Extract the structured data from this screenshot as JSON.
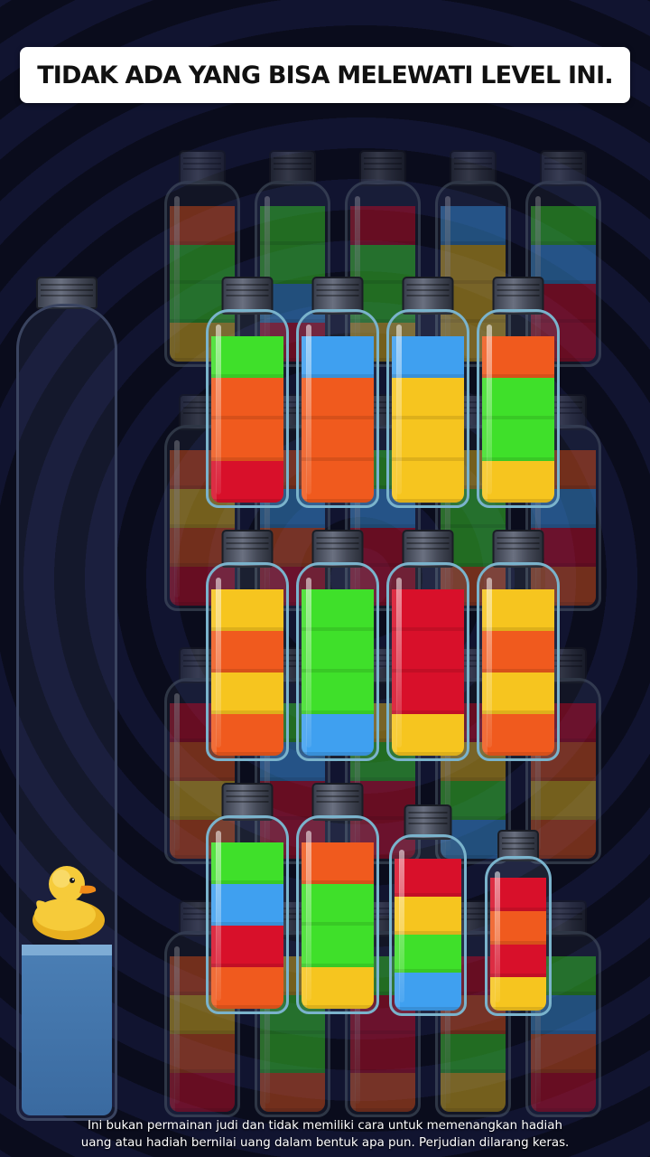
{
  "banner": {
    "title": "TIDAK ADA YANG BISA MELEWATI LEVEL INI."
  },
  "disclaimer": {
    "line1": "Ini bukan permainan judi dan tidak memiliki cara untuk memenangkan hadiah",
    "line2": "uang atau hadiah bernilai uang dalam bentuk apa pun. Perjudian dilarang keras."
  },
  "colors": {
    "green": "#3fe02a",
    "orange": "#f05a1e",
    "red": "#d8102a",
    "blue": "#3fa0f0",
    "yellow": "#f6c51f",
    "water": "#3a6aa0"
  },
  "front_bottles": [
    {
      "layers": [
        "red",
        "orange",
        "orange",
        "green"
      ],
      "fill": 0.94
    },
    {
      "layers": [
        "orange",
        "orange",
        "orange",
        "blue"
      ],
      "fill": 0.94
    },
    {
      "layers": [
        "yellow",
        "yellow",
        "yellow",
        "blue"
      ],
      "fill": 0.94
    },
    {
      "layers": [
        "yellow",
        "green",
        "green",
        "orange"
      ],
      "fill": 0.94
    },
    {
      "layers": [
        "orange",
        "yellow",
        "orange",
        "yellow"
      ],
      "fill": 0.94
    },
    {
      "layers": [
        "blue",
        "green",
        "green",
        "green"
      ],
      "fill": 0.94
    },
    {
      "layers": [
        "yellow",
        "red",
        "red",
        "red"
      ],
      "fill": 0.94
    },
    {
      "layers": [
        "orange",
        "yellow",
        "orange",
        "yellow"
      ],
      "fill": 0.94
    },
    {
      "layers": [
        "orange",
        "red",
        "blue",
        "green"
      ],
      "fill": 0.94
    },
    {
      "layers": [
        "yellow",
        "green",
        "green",
        "orange"
      ],
      "fill": 0.94
    },
    {
      "layers": [
        "blue",
        "green",
        "yellow",
        "red"
      ],
      "fill": 0.94
    },
    {
      "layers": [
        "yellow",
        "red",
        "orange",
        "red"
      ],
      "fill": 0.94
    }
  ],
  "back_bottles": [
    {
      "layers": [
        "yellow",
        "green",
        "green",
        "orange"
      ]
    },
    {
      "layers": [
        "red",
        "blue",
        "green",
        "green"
      ]
    },
    {
      "layers": [
        "yellow",
        "green",
        "green",
        "red"
      ]
    },
    {
      "layers": [
        "yellow",
        "yellow",
        "yellow",
        "blue"
      ]
    },
    {
      "layers": [
        "red",
        "red",
        "blue",
        "green"
      ]
    },
    {
      "layers": [
        "red",
        "orange",
        "yellow",
        "orange"
      ]
    },
    {
      "layers": [
        "red",
        "orange",
        "blue",
        "orange"
      ]
    },
    {
      "layers": [
        "red",
        "red",
        "blue",
        "green"
      ]
    },
    {
      "layers": [
        "orange",
        "green",
        "green",
        "yellow"
      ]
    },
    {
      "layers": [
        "orange",
        "red",
        "blue",
        "orange"
      ]
    },
    {
      "layers": [
        "orange",
        "yellow",
        "orange",
        "red"
      ]
    },
    {
      "layers": [
        "red",
        "red",
        "blue",
        "green"
      ]
    },
    {
      "layers": [
        "red",
        "red",
        "green",
        "yellow"
      ]
    },
    {
      "layers": [
        "blue",
        "green",
        "yellow",
        "red"
      ]
    },
    {
      "layers": [
        "orange",
        "yellow",
        "orange",
        "red"
      ]
    },
    {
      "layers": [
        "red",
        "orange",
        "yellow",
        "orange"
      ]
    },
    {
      "layers": [
        "orange",
        "green",
        "green",
        "yellow"
      ]
    },
    {
      "layers": [
        "orange",
        "red",
        "red",
        "green"
      ]
    },
    {
      "layers": [
        "yellow",
        "green",
        "orange",
        "red"
      ]
    },
    {
      "layers": [
        "red",
        "orange",
        "blue",
        "green"
      ]
    }
  ],
  "tube": {
    "water_level": 0.21
  }
}
